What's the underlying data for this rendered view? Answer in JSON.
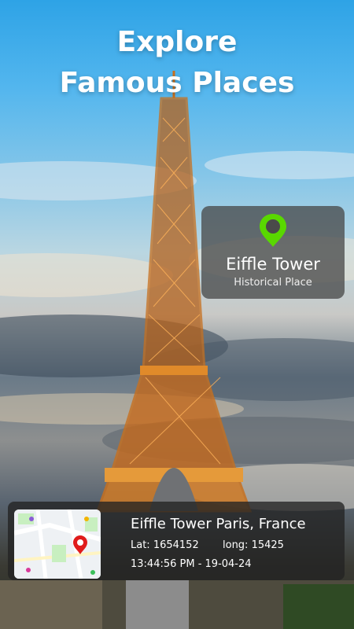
{
  "headline": {
    "line1": "Explore",
    "line2": "Famous Places"
  },
  "place_card": {
    "title": "Eiffle Tower",
    "subtitle": "Historical Place",
    "pin_color": "#59d800"
  },
  "info_card": {
    "title": "Eiffle Tower Paris, France",
    "lat": "Lat: 1654152",
    "long": "long: 15425",
    "timestamp": "13:44:56 PM - 19-04-24",
    "marker_color": "#e01b1b"
  },
  "icons": [
    "location-pin-icon",
    "map-marker-icon"
  ]
}
